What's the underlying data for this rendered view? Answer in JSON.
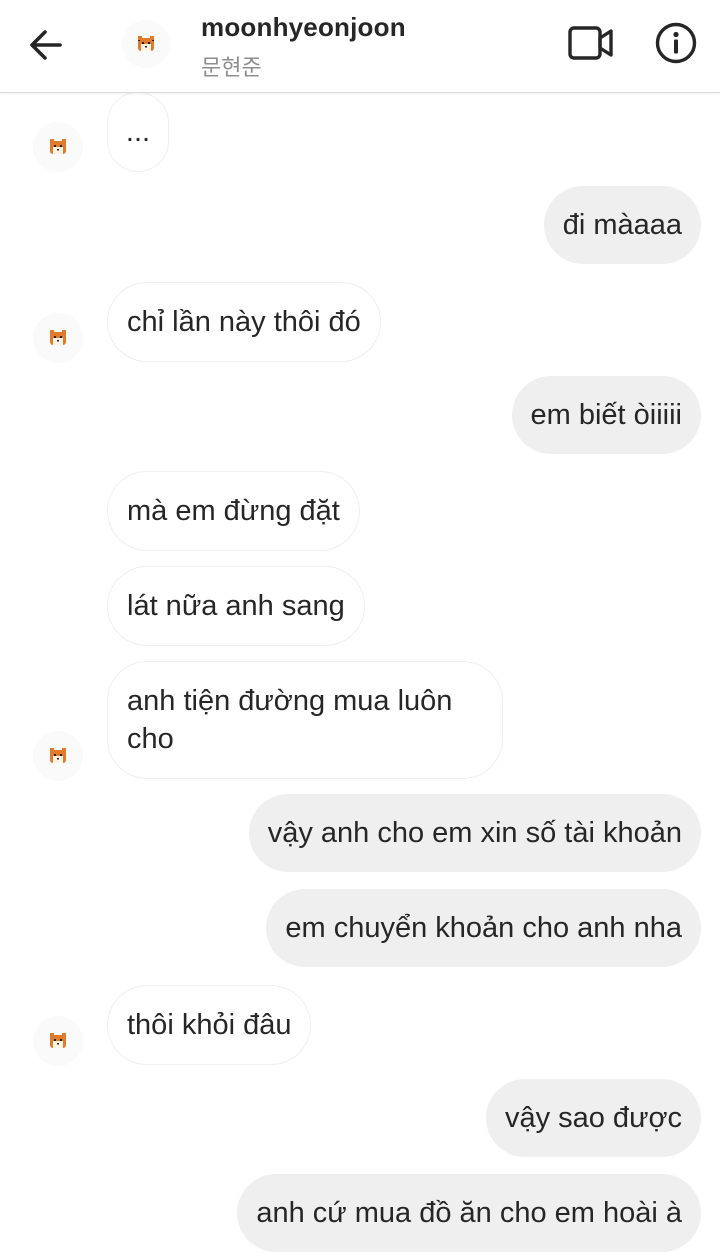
{
  "header": {
    "username": "moonhyeonjoon",
    "subtitle": "문현준"
  },
  "icons": {
    "back": "arrow-left-icon",
    "video": "video-camera-icon",
    "info": "info-circle-icon",
    "avatar": "tiger-avatar-icon"
  },
  "messages": [
    {
      "side": "in",
      "text": "..."
    },
    {
      "side": "out",
      "text": "đi màaaa"
    },
    {
      "side": "in",
      "text": "chỉ lần này thôi đó"
    },
    {
      "side": "out",
      "text": "em biết òiiiii"
    },
    {
      "side": "in",
      "text": "mà em đừng đặt"
    },
    {
      "side": "in",
      "text": "lát nữa anh sang"
    },
    {
      "side": "in",
      "text": "anh tiện đường mua luôn cho"
    },
    {
      "side": "out",
      "text": "vậy anh cho em xin số tài khoản"
    },
    {
      "side": "out",
      "text": "em chuyển khoản cho anh nha"
    },
    {
      "side": "in",
      "text": "thôi khỏi đâu"
    },
    {
      "side": "out",
      "text": "vậy sao được"
    },
    {
      "side": "out",
      "text": "anh cứ mua đồ ăn cho em hoài à"
    }
  ]
}
